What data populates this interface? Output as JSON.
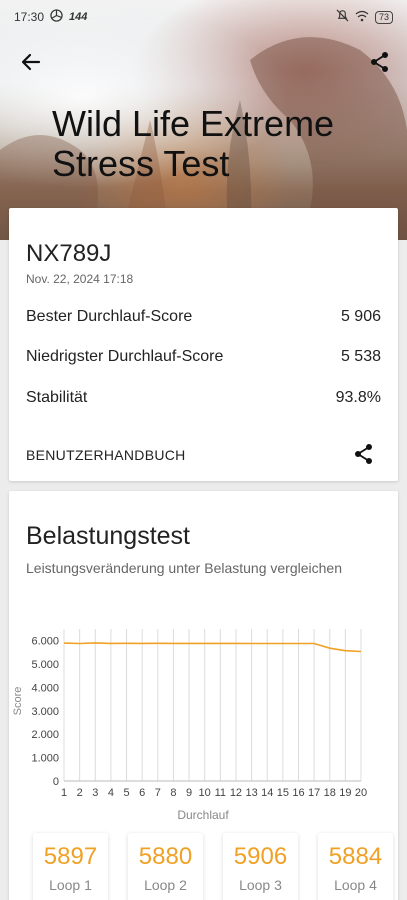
{
  "status_bar": {
    "time": "17:30",
    "refresh": "144",
    "battery": "73"
  },
  "header": {
    "title": "Wild Life Extreme Stress Test",
    "back_icon": "arrow-left-icon",
    "share_icon": "share-icon"
  },
  "summary": {
    "device": "NX789J",
    "date": "Nov. 22, 2024 17:18",
    "rows": [
      {
        "label": "Bester Durchlauf-Score",
        "value": "5 906"
      },
      {
        "label": "Niedrigster Durchlauf-Score",
        "value": "5 538"
      },
      {
        "label": "Stabilität",
        "value": "93.8%"
      }
    ],
    "manual_label": "BENUTZERHANDBUCH"
  },
  "stress": {
    "title": "Belastungstest",
    "subtitle": "Leistungsveränderung unter Belastung vergleichen"
  },
  "chart_data": {
    "type": "line",
    "xlabel": "Durchlauf",
    "ylabel": "Score",
    "x": [
      1,
      2,
      3,
      4,
      5,
      6,
      7,
      8,
      9,
      10,
      11,
      12,
      13,
      14,
      15,
      16,
      17,
      18,
      19,
      20
    ],
    "y_ticks": [
      "0",
      "1.000",
      "2.000",
      "3.000",
      "4.000",
      "5.000",
      "6.000"
    ],
    "ylim": [
      0,
      6500
    ],
    "series": [
      {
        "values": [
          5897,
          5880,
          5906,
          5884,
          5890,
          5885,
          5888,
          5886,
          5884,
          5885,
          5884,
          5883,
          5882,
          5882,
          5881,
          5880,
          5880,
          5680,
          5570,
          5538
        ]
      }
    ],
    "color": "#f0a125",
    "grid": "vertical"
  },
  "loops": [
    {
      "value": "5897",
      "label": "Loop 1"
    },
    {
      "value": "5880",
      "label": "Loop 2"
    },
    {
      "value": "5906",
      "label": "Loop 3"
    },
    {
      "value": "5884",
      "label": "Loop 4"
    }
  ]
}
